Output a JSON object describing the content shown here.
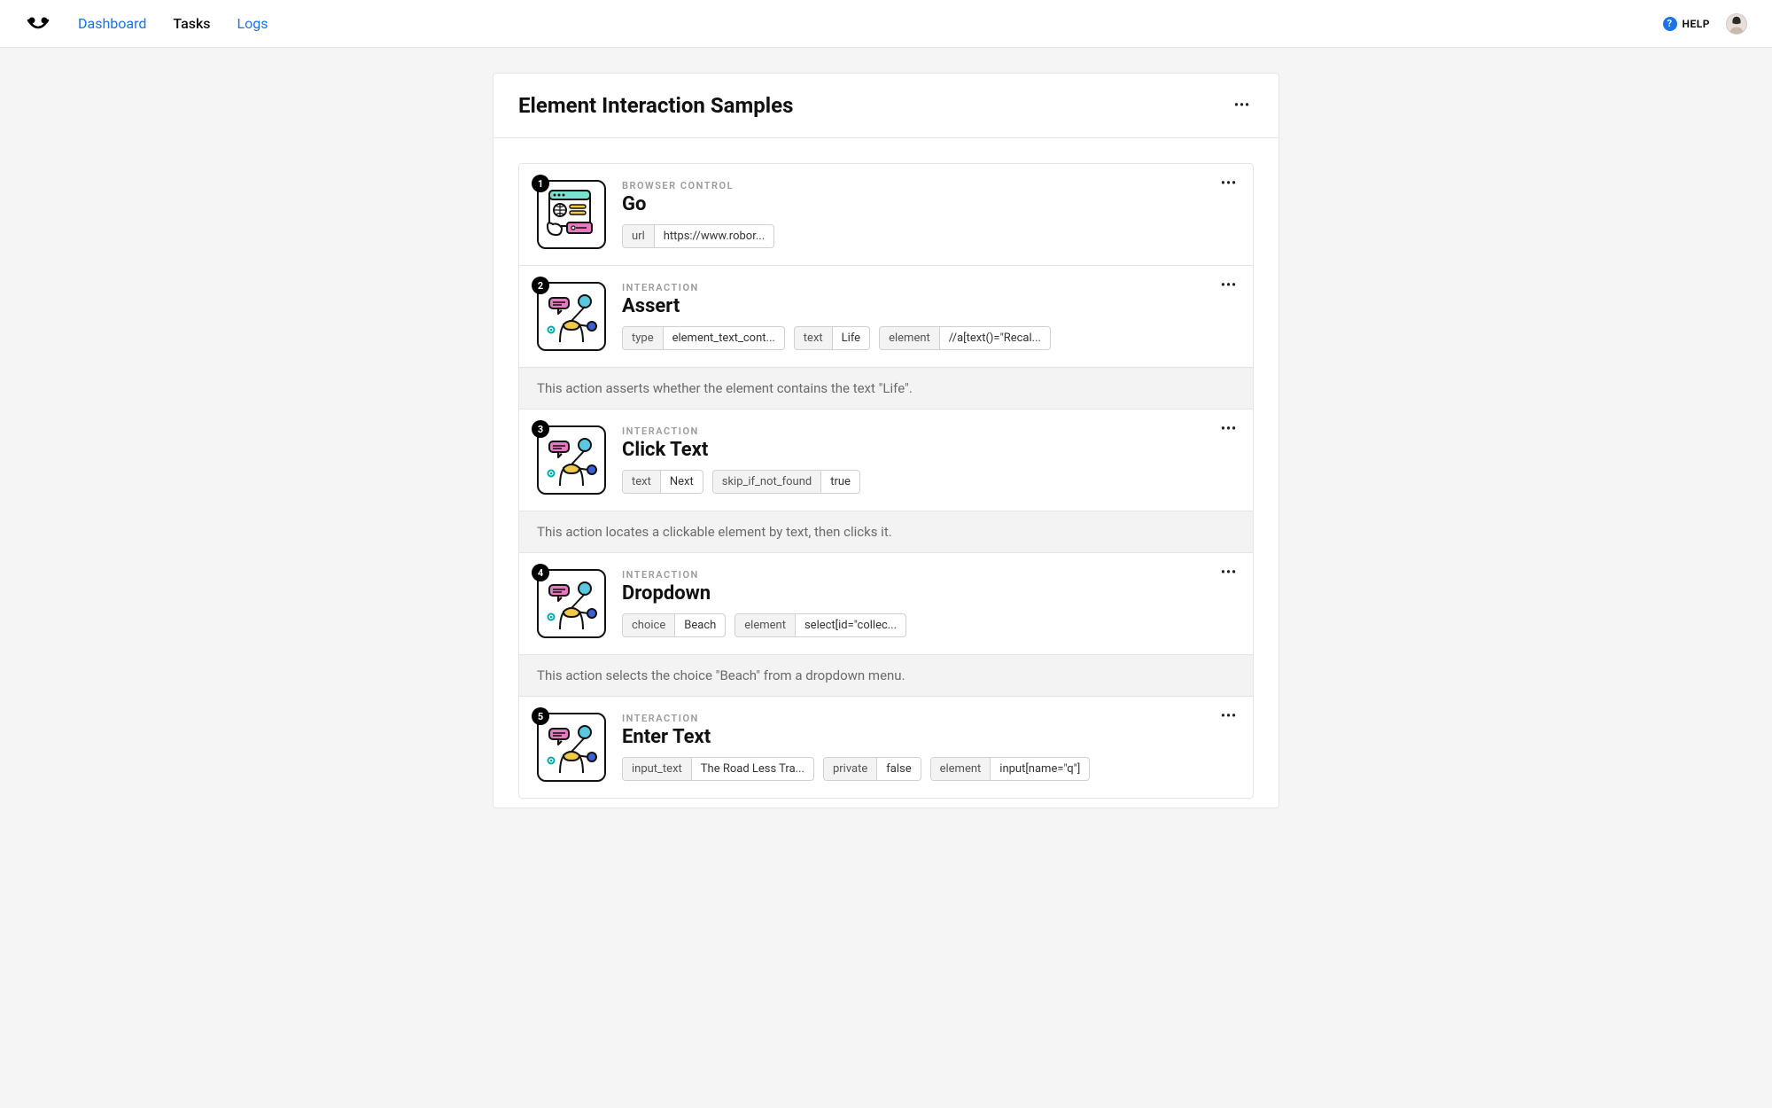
{
  "nav": {
    "items": [
      {
        "label": "Dashboard",
        "active": false
      },
      {
        "label": "Tasks",
        "active": true
      },
      {
        "label": "Logs",
        "active": false
      }
    ]
  },
  "help": {
    "label": "HELP"
  },
  "card": {
    "title": "Element Interaction Samples"
  },
  "steps": [
    {
      "num": "1",
      "category": "BROWSER CONTROL",
      "title": "Go",
      "icon": "browser",
      "params": [
        {
          "key": "url",
          "val": "https://www.robor..."
        }
      ],
      "desc": null
    },
    {
      "num": "2",
      "category": "INTERACTION",
      "title": "Assert",
      "icon": "interaction",
      "params": [
        {
          "key": "type",
          "val": "element_text_cont..."
        },
        {
          "key": "text",
          "val": "Life"
        },
        {
          "key": "element",
          "val": "//a[text()=\"Recal..."
        }
      ],
      "desc": "This action asserts whether the element contains the text \"Life\"."
    },
    {
      "num": "3",
      "category": "INTERACTION",
      "title": "Click Text",
      "icon": "interaction",
      "params": [
        {
          "key": "text",
          "val": "Next"
        },
        {
          "key": "skip_if_not_found",
          "val": "true"
        }
      ],
      "desc": "This action locates a clickable element by text, then clicks it."
    },
    {
      "num": "4",
      "category": "INTERACTION",
      "title": "Dropdown",
      "icon": "interaction",
      "params": [
        {
          "key": "choice",
          "val": "Beach"
        },
        {
          "key": "element",
          "val": "select[id=\"collec..."
        }
      ],
      "desc": "This action selects the choice \"Beach\" from a dropdown menu."
    },
    {
      "num": "5",
      "category": "INTERACTION",
      "title": "Enter Text",
      "icon": "interaction",
      "params": [
        {
          "key": "input_text",
          "val": "The Road Less Tra..."
        },
        {
          "key": "private",
          "val": "false"
        },
        {
          "key": "element",
          "val": "input[name=\"q\"]"
        }
      ],
      "desc": null
    }
  ]
}
